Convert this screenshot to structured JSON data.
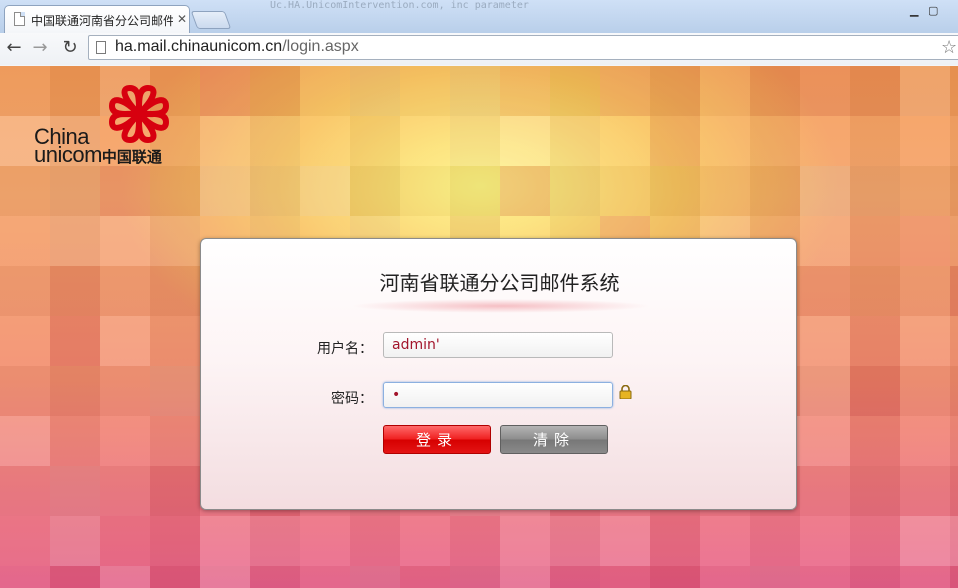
{
  "browser": {
    "tab_title": "中国联通河南省分公司邮件",
    "url_domain": "ha.mail.chinaunicom.cn",
    "url_path": "/login.aspx",
    "background_text": "Uc.HA.UnicomIntervention.com, inc parameter"
  },
  "logo": {
    "line1": "China",
    "line2": "unicom",
    "cn": "中国联通",
    "brand_color": "#d7000f"
  },
  "login": {
    "title": "河南省联通分公司邮件系统",
    "username_label": "用户名：",
    "username_value": "admin'",
    "password_label": "密码：",
    "password_value": "•",
    "login_button": "登录",
    "clear_button": "清除"
  },
  "icons": {
    "back": "back-arrow-icon",
    "forward": "forward-arrow-icon",
    "reload": "reload-icon",
    "bookmark": "star-icon",
    "lock": "lock-icon"
  }
}
